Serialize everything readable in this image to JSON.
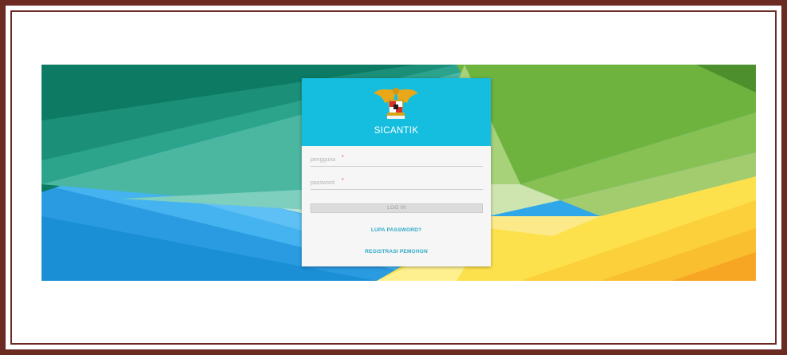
{
  "app": {
    "title": "SICANTIK"
  },
  "form": {
    "username_placeholder": "pengguna",
    "password_placeholder": "password",
    "required_mark": "*",
    "login_label": "LOG IN"
  },
  "links": {
    "forgot_password": "LUPA PASSWORD?",
    "register": "REGISTRASI PEMOHON"
  },
  "colors": {
    "header": "#15bedf",
    "frame": "#6b2a22",
    "link": "#2ea9c6"
  },
  "icons": {
    "emblem": "garuda-pancasila-emblem"
  }
}
